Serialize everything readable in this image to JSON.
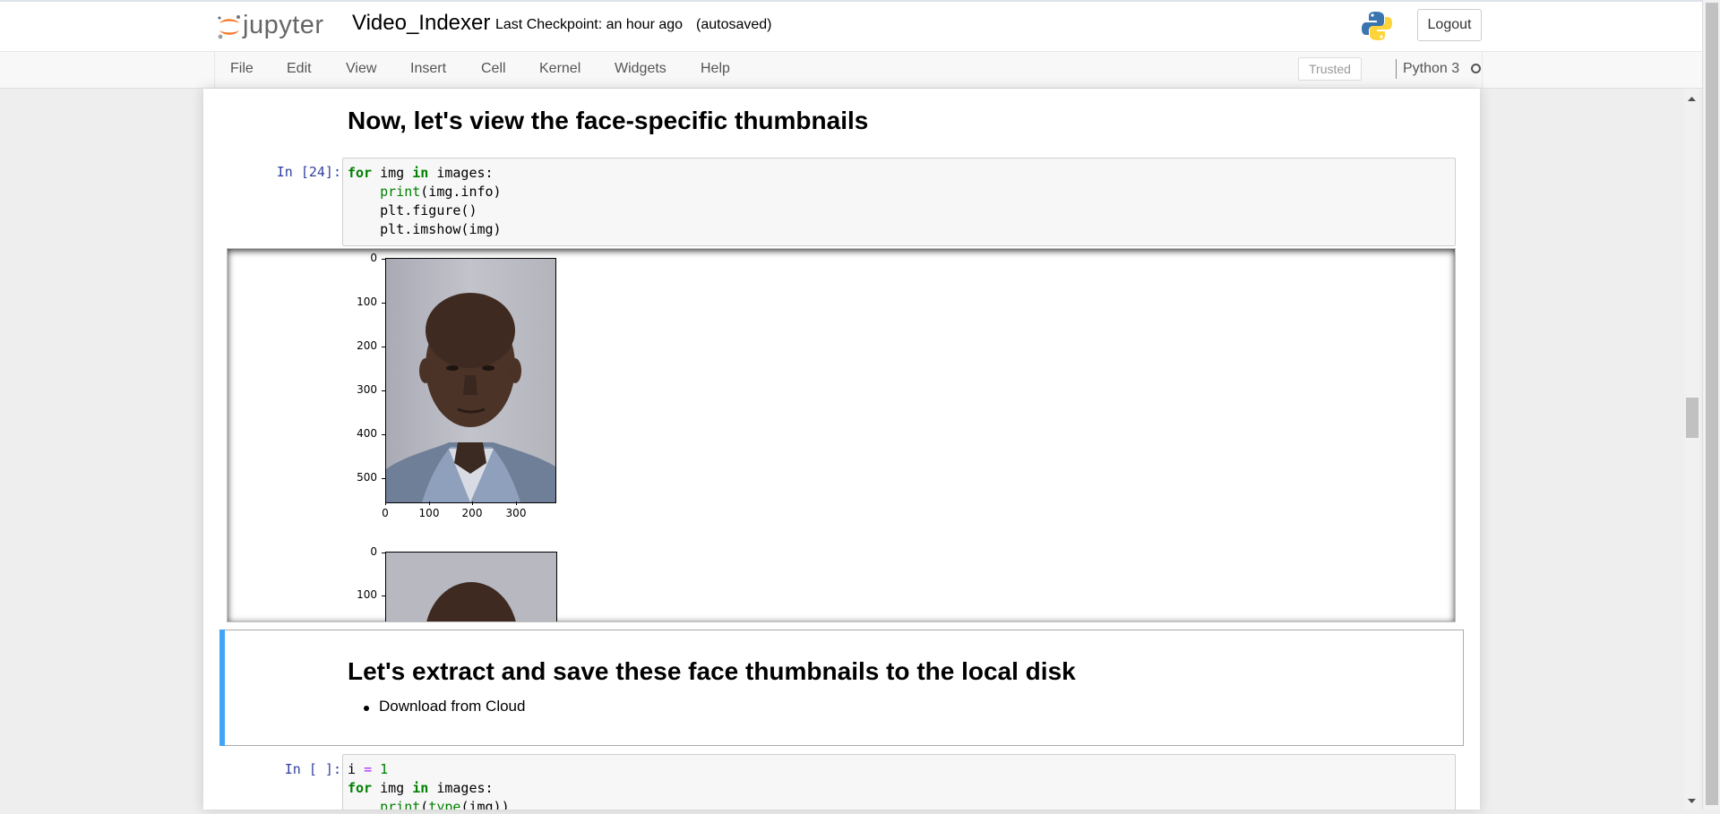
{
  "header": {
    "logo_text": "jupyter",
    "notebook_name": "Video_Indexer",
    "checkpoint": "Last Checkpoint: an hour ago",
    "autosave": "(autosaved)",
    "logout_label": "Logout"
  },
  "menu": {
    "items": [
      "File",
      "Edit",
      "View",
      "Insert",
      "Cell",
      "Kernel",
      "Widgets",
      "Help"
    ],
    "trusted_label": "Trusted",
    "kernel_name": "Python 3"
  },
  "cells": {
    "heading1": "Now, let's view the face-specific thumbnails",
    "cell24_prompt": "In [24]:",
    "cell24_code": {
      "line1_kw1": "for",
      "line1_a": " img ",
      "line1_kw2": "in",
      "line1_b": " images:",
      "line2_fn": "print",
      "line2_rest": "(img.info)",
      "line3": "    plt.figure()",
      "line4": "    plt.imshow(img)"
    },
    "output_plot1": {
      "y_ticks": [
        "0",
        "100",
        "200",
        "300",
        "400",
        "500"
      ],
      "x_ticks": [
        "0",
        "100",
        "200",
        "300"
      ]
    },
    "output_plot2": {
      "y_ticks": [
        "0",
        "100"
      ]
    },
    "heading2": "Let's extract and save these face thumbnails to the local disk",
    "bullet1": "Download from Cloud",
    "cell_next_prompt": "In [ ]:",
    "cell_next_code": {
      "l1_a": "i ",
      "l1_op": "=",
      "l1_num": "1",
      "l2_kw1": "for",
      "l2_a": " img ",
      "l2_kw2": "in",
      "l2_b": " images:",
      "l3_fn": "print",
      "l3_mid": "(",
      "l3_fn2": "type",
      "l3_rest": "(img))"
    }
  },
  "colors": {
    "prompt_in": "#303f9f",
    "selected_bar": "#42a5f5",
    "keyword": "#008000"
  }
}
